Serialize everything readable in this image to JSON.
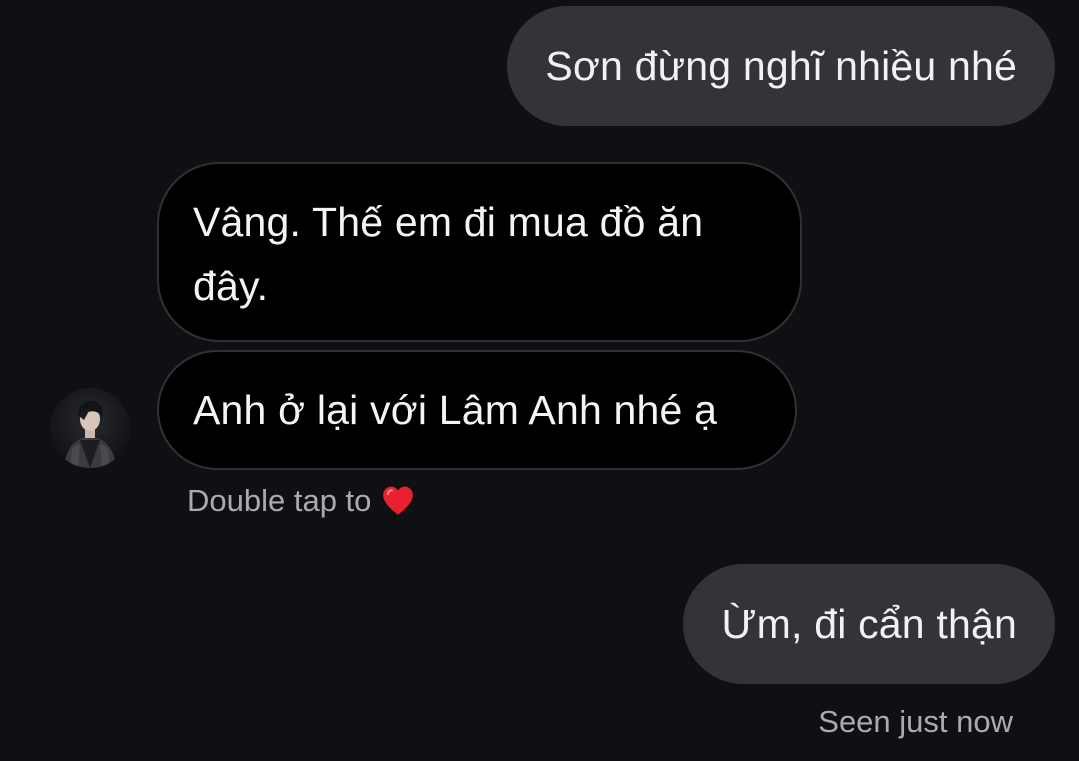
{
  "conversation": {
    "messages": [
      {
        "direction": "outgoing",
        "text": "Sơn đừng nghĩ nhiều nhé"
      },
      {
        "direction": "incoming",
        "text": "Vâng. Thế em đi mua đồ ăn đây."
      },
      {
        "direction": "incoming",
        "text": "Anh ở lại với Lâm Anh nhé ạ"
      },
      {
        "direction": "outgoing",
        "text": "Ừm, đi cẩn thận"
      }
    ],
    "like_hint": "Double tap to",
    "like_icon": "heart-icon",
    "seen_status": "Seen just now"
  },
  "colors": {
    "background": "#0f1014",
    "outgoing_bubble": "#333438",
    "incoming_bubble": "#000000",
    "incoming_border": "#303135",
    "secondary_text": "#a9aab2",
    "heart": "#e8202f"
  }
}
